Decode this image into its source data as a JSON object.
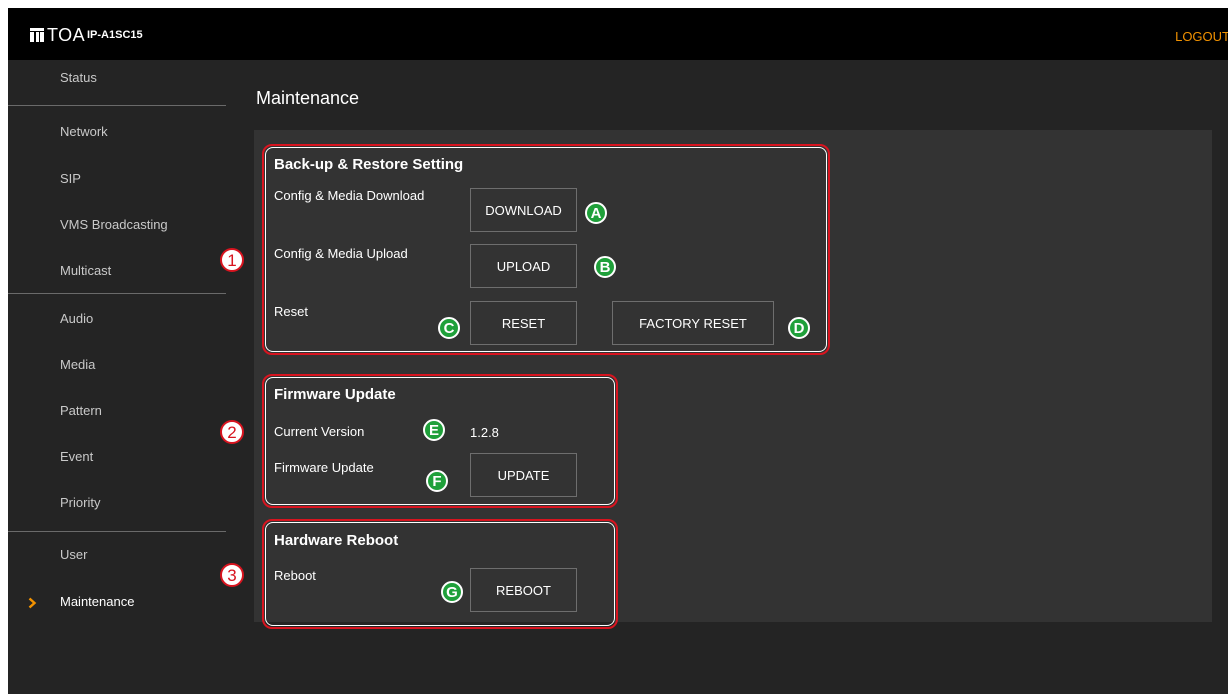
{
  "header": {
    "brand": "TOA",
    "model": "IP-A1SC15",
    "logout_label": "LOGOUT"
  },
  "sidebar": {
    "items": [
      {
        "label": "Status"
      },
      {
        "label": "Network"
      },
      {
        "label": "SIP"
      },
      {
        "label": "VMS Broadcasting"
      },
      {
        "label": "Multicast"
      },
      {
        "label": "Audio"
      },
      {
        "label": "Media"
      },
      {
        "label": "Pattern"
      },
      {
        "label": "Event"
      },
      {
        "label": "Priority"
      },
      {
        "label": "User"
      },
      {
        "label": "Maintenance"
      }
    ],
    "active": "Maintenance"
  },
  "page": {
    "title": "Maintenance"
  },
  "backup": {
    "title": "Back-up & Restore Setting",
    "download_label": "Config & Media Download",
    "download_button": "DOWNLOAD",
    "upload_label": "Config & Media Upload",
    "upload_button": "UPLOAD",
    "reset_label": "Reset",
    "reset_button": "RESET",
    "factory_reset_button": "FACTORY RESET"
  },
  "firmware": {
    "title": "Firmware Update",
    "version_label": "Current Version",
    "version_value": "1.2.8",
    "update_label": "Firmware Update",
    "update_button": "UPDATE"
  },
  "reboot": {
    "title": "Hardware Reboot",
    "reboot_label": "Reboot",
    "reboot_button": "REBOOT"
  },
  "callouts": {
    "sections": [
      "1",
      "2",
      "3"
    ],
    "items": [
      "A",
      "B",
      "C",
      "D",
      "E",
      "F",
      "G"
    ]
  },
  "colors": {
    "accent": "#f29200",
    "callout_red": "#d8141f",
    "callout_green": "#1fa03a",
    "panel": "#333333",
    "background": "#242424"
  }
}
